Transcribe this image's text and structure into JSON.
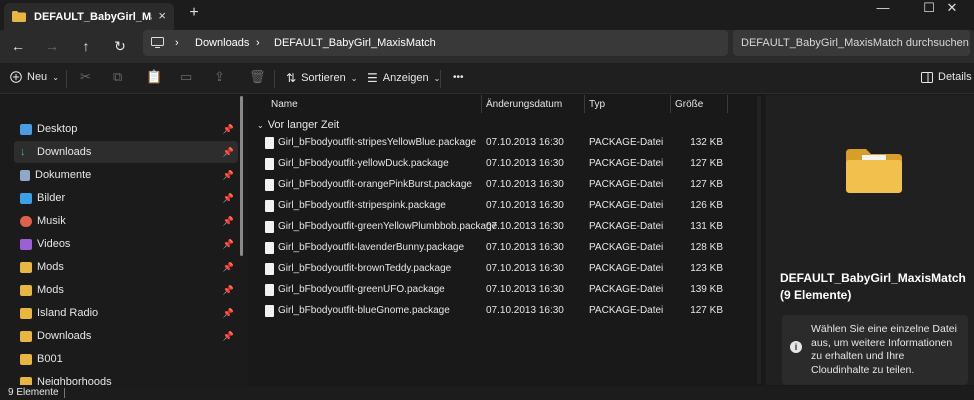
{
  "window": {
    "tab_title": "DEFAULT_BabyGirl_MaxisMatch",
    "tab_close": "×",
    "new_tab": "+",
    "minimize": "—",
    "maximize": "☐",
    "close": "✕"
  },
  "nav": {
    "back": "←",
    "forward": "→",
    "up": "↑",
    "refresh": "↻",
    "breadcrumb": [
      "Downloads",
      "DEFAULT_BabyGirl_MaxisMatch"
    ],
    "breadcrumb_sep": "›",
    "search_placeholder": "DEFAULT_BabyGirl_MaxisMatch durchsuchen"
  },
  "toolbar": {
    "new_label": "Neu",
    "sort_label": "Sortieren",
    "view_label": "Anzeigen",
    "more_label": "•••",
    "details_label": "Details"
  },
  "sidebar": {
    "items": [
      {
        "label": "Desktop",
        "icon": "desktop-icon",
        "pinned": true
      },
      {
        "label": "Downloads",
        "icon": "download-icon",
        "pinned": true,
        "active": true
      },
      {
        "label": "Dokumente",
        "icon": "document-icon",
        "pinned": true
      },
      {
        "label": "Bilder",
        "icon": "pictures-icon",
        "pinned": true
      },
      {
        "label": "Musik",
        "icon": "music-icon",
        "pinned": true
      },
      {
        "label": "Videos",
        "icon": "videos-icon",
        "pinned": true
      },
      {
        "label": "Mods",
        "icon": "folder-icon",
        "pinned": true
      },
      {
        "label": "Mods",
        "icon": "folder-icon",
        "pinned": true
      },
      {
        "label": "Island Radio",
        "icon": "folder-icon",
        "pinned": true
      },
      {
        "label": "Downloads",
        "icon": "folder-icon",
        "pinned": true
      },
      {
        "label": "B001",
        "icon": "folder-icon",
        "pinned": false
      },
      {
        "label": "Neighborhoods",
        "icon": "folder-icon",
        "pinned": false
      }
    ],
    "pin_glyph": "📌"
  },
  "filelist": {
    "columns": [
      "Name",
      "Änderungsdatum",
      "Typ",
      "Größe"
    ],
    "group_label": "Vor langer Zeit",
    "rows": [
      {
        "name": "Girl_bFbodyoutfit-stripesYellowBlue.package",
        "date": "07.10.2013 16:30",
        "type": "PACKAGE-Datei",
        "size": "132 KB"
      },
      {
        "name": "Girl_bFbodyoutfit-yellowDuck.package",
        "date": "07.10.2013 16:30",
        "type": "PACKAGE-Datei",
        "size": "127 KB"
      },
      {
        "name": "Girl_bFbodyoutfit-orangePinkBurst.package",
        "date": "07.10.2013 16:30",
        "type": "PACKAGE-Datei",
        "size": "127 KB"
      },
      {
        "name": "Girl_bFbodyoutfit-stripespink.package",
        "date": "07.10.2013 16:30",
        "type": "PACKAGE-Datei",
        "size": "126 KB"
      },
      {
        "name": "Girl_bFbodyoutfit-greenYellowPlumbbob.package",
        "date": "07.10.2013 16:30",
        "type": "PACKAGE-Datei",
        "size": "131 KB"
      },
      {
        "name": "Girl_bFbodyoutfit-lavenderBunny.package",
        "date": "07.10.2013 16:30",
        "type": "PACKAGE-Datei",
        "size": "128 KB"
      },
      {
        "name": "Girl_bFbodyoutfit-brownTeddy.package",
        "date": "07.10.2013 16:30",
        "type": "PACKAGE-Datei",
        "size": "123 KB"
      },
      {
        "name": "Girl_bFbodyoutfit-greenUFO.package",
        "date": "07.10.2013 16:30",
        "type": "PACKAGE-Datei",
        "size": "139 KB"
      },
      {
        "name": "Girl_bFbodyoutfit-blueGnome.package",
        "date": "07.10.2013 16:30",
        "type": "PACKAGE-Datei",
        "size": "127 KB"
      }
    ]
  },
  "details": {
    "title": "DEFAULT_BabyGirl_MaxisMatch (9 Elemente)",
    "info": "Wählen Sie eine einzelne Datei aus, um weitere Informationen zu erhalten und Ihre Cloudinhalte zu teilen.",
    "info_icon": "i"
  },
  "status": {
    "count": "9 Elemente"
  },
  "colors": {
    "folder": "#e8b741",
    "background": "#191919",
    "accent": "#2d2d2d"
  }
}
